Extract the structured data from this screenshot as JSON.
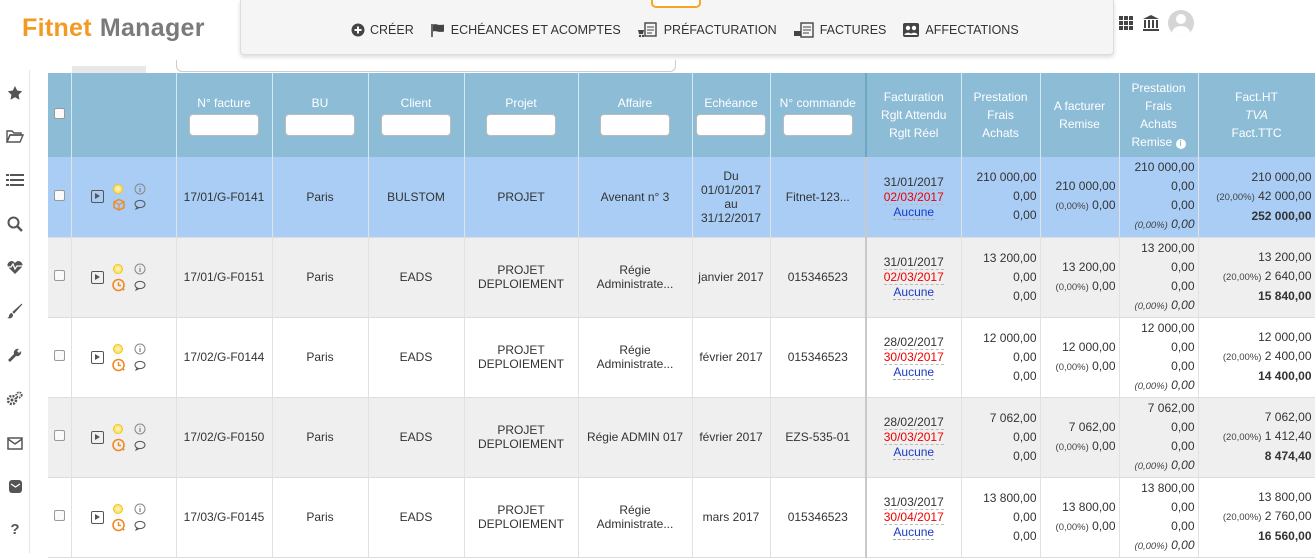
{
  "app": {
    "logo_part1": "Fitnet",
    "logo_part2": "Manager"
  },
  "nav": [
    {
      "label": "CRÉER",
      "icon": "plus-circle-icon"
    },
    {
      "label": "ECHÉANCES ET ACOMPTES",
      "icon": "flag-icon"
    },
    {
      "label": "PRÉFACTURATION",
      "icon": "document-cart-icon"
    },
    {
      "label": "FACTURES",
      "icon": "invoice-icon"
    },
    {
      "label": "AFFECTATIONS",
      "icon": "people-icon"
    }
  ],
  "table": {
    "headers": {
      "invoice_no": "N° facture",
      "bu": "BU",
      "client": "Client",
      "project": "Projet",
      "affair": "Affaire",
      "due": "Echéance",
      "order_no": "N° commande",
      "billing": [
        "Facturation",
        "Rglt Attendu",
        "Rglt Réel"
      ],
      "prestation": [
        "Prestation",
        "Frais",
        "Achats"
      ],
      "to_bill": [
        "A facturer",
        "Remise"
      ],
      "prestation2": [
        "Prestation",
        "Frais",
        "Achats",
        "Remise"
      ],
      "fact": [
        "Fact.HT",
        "TVA",
        "Fact.TTC"
      ]
    },
    "rows": [
      {
        "invoice": "17/01/G-F0141",
        "bu": "Paris",
        "client": "BULSTOM",
        "project": [
          "PROJET"
        ],
        "affair": [
          "Avenant n° 3"
        ],
        "due": [
          "Du",
          "01/01/2017",
          "au",
          "31/12/2017"
        ],
        "order": "Fitnet-123...",
        "billing": "31/01/2017",
        "expected": "02/03/2017",
        "real": "Aucune",
        "prest": "210 000,00",
        "frais": "0,00",
        "achats": "0,00",
        "tobill": "210 000,00",
        "tobill_pct": "(0,00%)",
        "tobill_remise": "0,00",
        "p2": "210 000,00",
        "f2": "0,00",
        "a2": "0,00",
        "r2_pct": "(0,00%)",
        "r2": "0,00",
        "ht": "210 000,00",
        "tva_pct": "(20,00%)",
        "tva": "42 000,00",
        "ttc": "252 000,00"
      },
      {
        "invoice": "17/01/G-F0151",
        "bu": "Paris",
        "client": "EADS",
        "project": [
          "PROJET",
          "DEPLOIEMENT"
        ],
        "affair": [
          "Régie",
          "Administrate..."
        ],
        "due": [
          "janvier 2017"
        ],
        "order": "015346523",
        "billing": "31/01/2017",
        "expected": "02/03/2017",
        "real": "Aucune",
        "prest": "13 200,00",
        "frais": "0,00",
        "achats": "0,00",
        "tobill": "13 200,00",
        "tobill_pct": "(0,00%)",
        "tobill_remise": "0,00",
        "p2": "13 200,00",
        "f2": "0,00",
        "a2": "0,00",
        "r2_pct": "(0,00%)",
        "r2": "0,00",
        "ht": "13 200,00",
        "tva_pct": "(20,00%)",
        "tva": "2 640,00",
        "ttc": "15 840,00"
      },
      {
        "invoice": "17/02/G-F0144",
        "bu": "Paris",
        "client": "EADS",
        "project": [
          "PROJET",
          "DEPLOIEMENT"
        ],
        "affair": [
          "Régie",
          "Administrate..."
        ],
        "due": [
          "février 2017"
        ],
        "order": "015346523",
        "billing": "28/02/2017",
        "expected": "30/03/2017",
        "real": "Aucune",
        "prest": "12 000,00",
        "frais": "0,00",
        "achats": "0,00",
        "tobill": "12 000,00",
        "tobill_pct": "(0,00%)",
        "tobill_remise": "0,00",
        "p2": "12 000,00",
        "f2": "0,00",
        "a2": "0,00",
        "r2_pct": "(0,00%)",
        "r2": "0,00",
        "ht": "12 000,00",
        "tva_pct": "(20,00%)",
        "tva": "2 400,00",
        "ttc": "14 400,00"
      },
      {
        "invoice": "17/02/G-F0150",
        "bu": "Paris",
        "client": "EADS",
        "project": [
          "PROJET",
          "DEPLOIEMENT"
        ],
        "affair": [
          "Régie ADMIN 017"
        ],
        "due": [
          "février 2017"
        ],
        "order": "EZS-535-01",
        "billing": "28/02/2017",
        "expected": "30/03/2017",
        "real": "Aucune",
        "prest": "7 062,00",
        "frais": "0,00",
        "achats": "0,00",
        "tobill": "7 062,00",
        "tobill_pct": "(0,00%)",
        "tobill_remise": "0,00",
        "p2": "7 062,00",
        "f2": "0,00",
        "a2": "0,00",
        "r2_pct": "(0,00%)",
        "r2": "0,00",
        "ht": "7 062,00",
        "tva_pct": "(20,00%)",
        "tva": "1 412,40",
        "ttc": "8 474,40"
      },
      {
        "invoice": "17/03/G-F0145",
        "bu": "Paris",
        "client": "EADS",
        "project": [
          "PROJET",
          "DEPLOIEMENT"
        ],
        "affair": [
          "Régie",
          "Administrate..."
        ],
        "due": [
          "mars 2017"
        ],
        "order": "015346523",
        "billing": "31/03/2017",
        "expected": "30/04/2017",
        "real": "Aucune",
        "prest": "13 800,00",
        "frais": "0,00",
        "achats": "0,00",
        "tobill": "13 800,00",
        "tobill_pct": "(0,00%)",
        "tobill_remise": "0,00",
        "p2": "13 800,00",
        "f2": "0,00",
        "a2": "0,00",
        "r2_pct": "(0,00%)",
        "r2": "0,00",
        "ht": "13 800,00",
        "tva_pct": "(20,00%)",
        "tva": "2 760,00",
        "ttc": "16 560,00"
      }
    ]
  }
}
